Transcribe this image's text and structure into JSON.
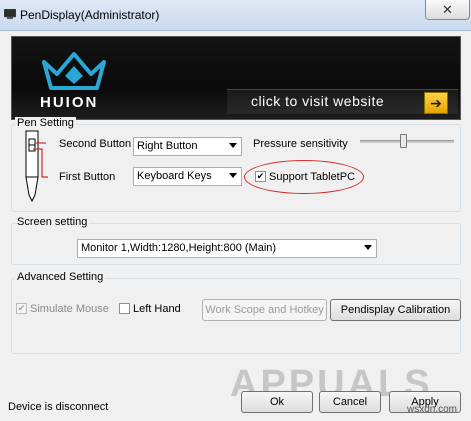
{
  "window": {
    "title": "PenDisplay(Administrator)",
    "close_symbol": "✕"
  },
  "banner": {
    "brand": "HUION",
    "visit_text": "click to visit website",
    "arrow_symbol": "➔"
  },
  "pen_setting": {
    "legend": "Pen Setting",
    "second_button_label": "Second Button",
    "second_button_value": "Right Button",
    "first_button_label": "First Button",
    "first_button_value": "Keyboard Keys",
    "pressure_label": "Pressure sensitivity",
    "support_tabletpc_label": "Support TabletPC",
    "support_tabletpc_checked": true
  },
  "screen_setting": {
    "legend": "Screen setting",
    "monitor_value": "Monitor 1,Width:1280,Height:800 (Main)"
  },
  "advanced_setting": {
    "legend": "Advanced Setting",
    "simulate_mouse_label": "Simulate Mouse",
    "simulate_mouse_checked": true,
    "left_hand_label": "Left Hand",
    "left_hand_checked": false,
    "work_scope_button": "Work Scope and Hotkey",
    "calibration_button": "Pendisplay Calibration"
  },
  "footer": {
    "status": "Device is disconnect",
    "ok_button": "Ok",
    "cancel_button": "Cancel",
    "apply_button": "Apply"
  },
  "watermark": {
    "text": "APPUALS",
    "url": "wsxdn.com"
  },
  "colors": {
    "highlight_red": "#d12a2a",
    "arrow_yellow": "#f0b400"
  }
}
